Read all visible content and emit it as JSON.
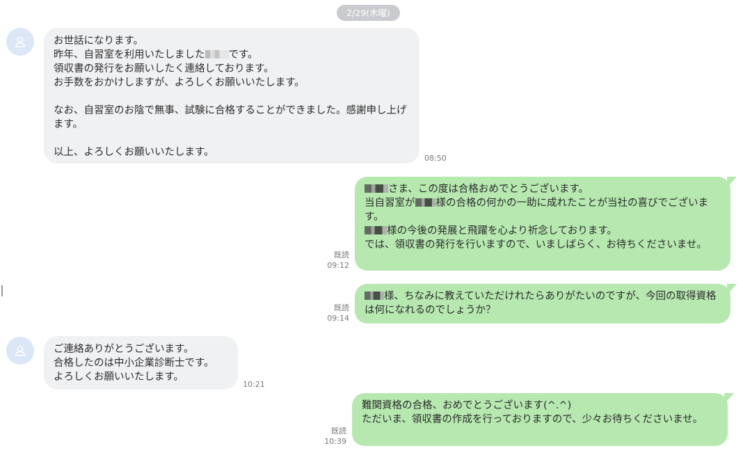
{
  "date_label": "2/29(木曜)",
  "messages": [
    {
      "sender": "customer",
      "lines_a": "お世話になります。\n昨年、自習室を利用いたしました",
      "lines_b": "です。\n領収書の発行をお願いしたく連絡しております。\nお手数をおかけしますが、よろしくお願いいたします。\n\nなお、自習室のお陰で無事、試験に合格することができました。感謝申し上げます。\n\n以上、よろしくお願いいたします。",
      "time": "08:50"
    },
    {
      "sender": "me",
      "line1_b": "さま、この度は合格おめでとうございます。",
      "line2_a": "当自習室が",
      "line2_b": "様の合格の何かの一助に成れたことが当社の喜びでございます。",
      "line3_b": "様の今後の発展と飛躍を心より祈念しております。",
      "line4": "では、領収書の発行を行いますので、いましばらく、お待ちくださいませ。",
      "read": "既読",
      "time": "09:12"
    },
    {
      "sender": "me",
      "text_b": "様、ちなみに教えていただけれたらありがたいのですが、今回の取得資格は何になれるのでしょうか？",
      "read": "既読",
      "time": "09:14"
    },
    {
      "sender": "customer",
      "text": "ご連絡ありがとうございます。\n合格したのは中小企業診断士です。\nよろしくお願いいたします。",
      "time": "10:21"
    },
    {
      "sender": "me",
      "text": "難関資格の合格、おめでとうございます(^.^)\nただいま、領収書の作成を行っておりますので、少々お待ちくださいませ。",
      "read": "既読",
      "time": "10:39"
    }
  ]
}
